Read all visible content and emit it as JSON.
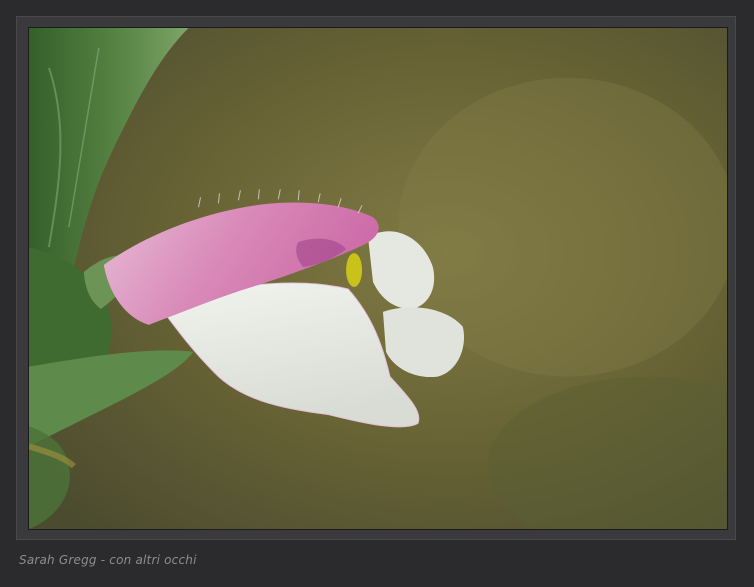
{
  "caption": "Sarah Gregg - con altri occhi",
  "colors": {
    "page_background": "#2b2b2d",
    "frame": "#3a3a3c",
    "caption_text": "#8d8d8d",
    "background_blur": "#6a6534",
    "petal_pink": "#d98ab8",
    "petal_white": "#e9ece6",
    "stem_green": "#4f7a3c",
    "stamen_yellow": "#c9c21a"
  }
}
